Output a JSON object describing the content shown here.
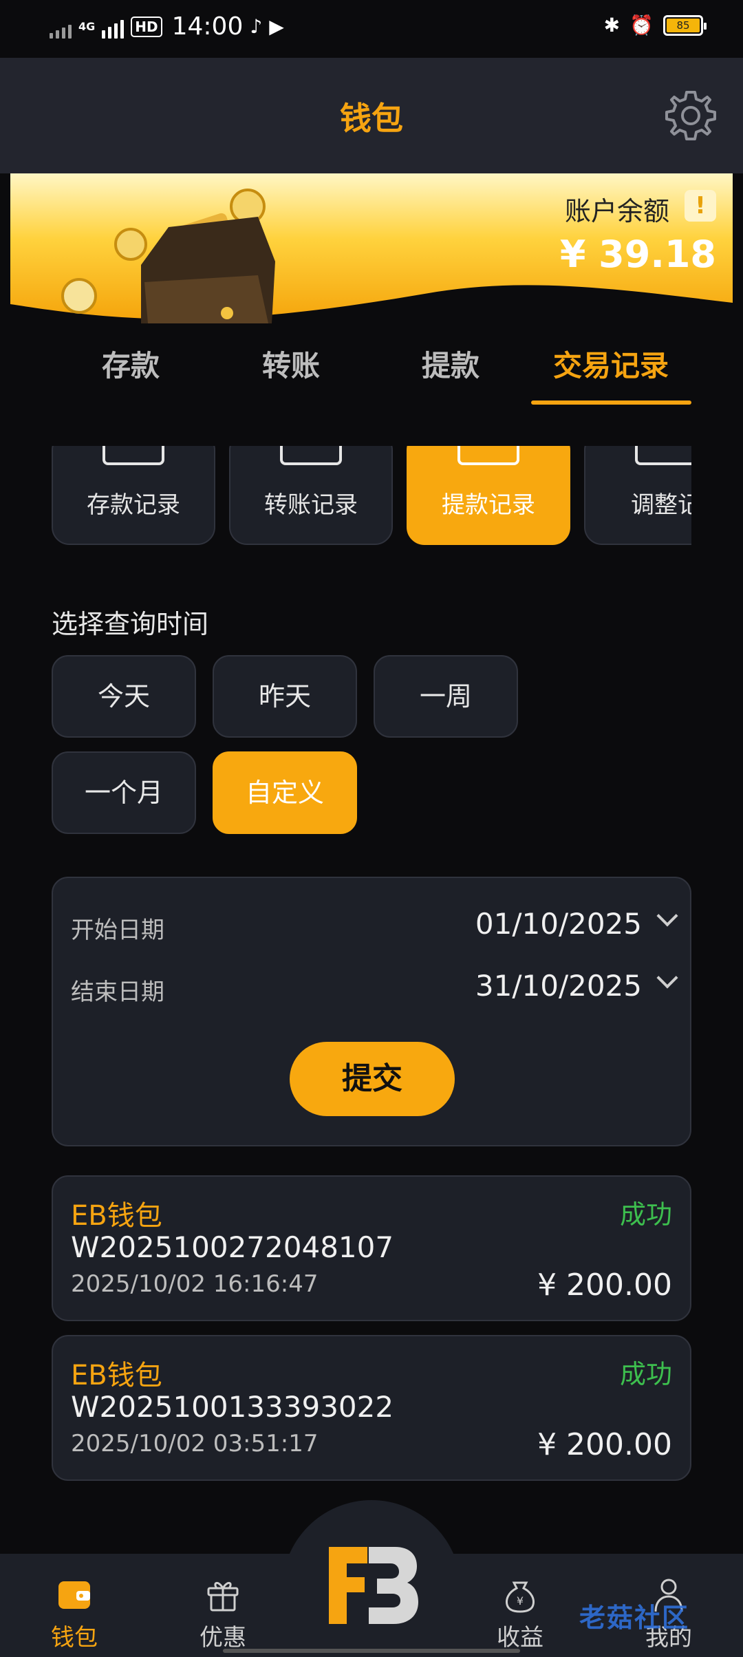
{
  "status_bar": {
    "network": "4G",
    "hd": "HD",
    "time": "14:00",
    "battery": "85"
  },
  "header": {
    "title": "钱包"
  },
  "banner": {
    "balance_label": "账户余额",
    "balance_value": "¥ 39.18"
  },
  "tabs": [
    {
      "label": "存款"
    },
    {
      "label": "转账"
    },
    {
      "label": "提款"
    },
    {
      "label": "交易记录"
    }
  ],
  "record_types": [
    {
      "label": "存款记录"
    },
    {
      "label": "转账记录"
    },
    {
      "label": "提款记录"
    },
    {
      "label": "调整记"
    }
  ],
  "query": {
    "label": "选择查询时间",
    "options": [
      "今天",
      "昨天",
      "一周",
      "一个月",
      "自定义"
    ],
    "selected": "自定义"
  },
  "date_filter": {
    "start_label": "开始日期",
    "start_value": "01/10/2025",
    "end_label": "结束日期",
    "end_value": "31/10/2025",
    "submit_label": "提交"
  },
  "records": [
    {
      "wallet": "EB钱包",
      "status": "成功",
      "id": "W2025100272048107",
      "time": "2025/10/02 16:16:47",
      "amount": "¥ 200.00"
    },
    {
      "wallet": "EB钱包",
      "status": "成功",
      "id": "W2025100133393022",
      "time": "2025/10/02 03:51:17",
      "amount": "¥ 200.00"
    }
  ],
  "bottom_nav": [
    {
      "label": "钱包",
      "icon": "wallet-icon"
    },
    {
      "label": "优惠",
      "icon": "gift-icon"
    },
    {
      "label": "收益",
      "icon": "money-bag-icon"
    },
    {
      "label": "我的",
      "icon": "user-icon"
    }
  ],
  "watermark": "老菇社区",
  "colors": {
    "accent": "#f6a411",
    "success": "#3dbf4e",
    "panel": "#1d2028",
    "background": "#0b0b0d"
  }
}
